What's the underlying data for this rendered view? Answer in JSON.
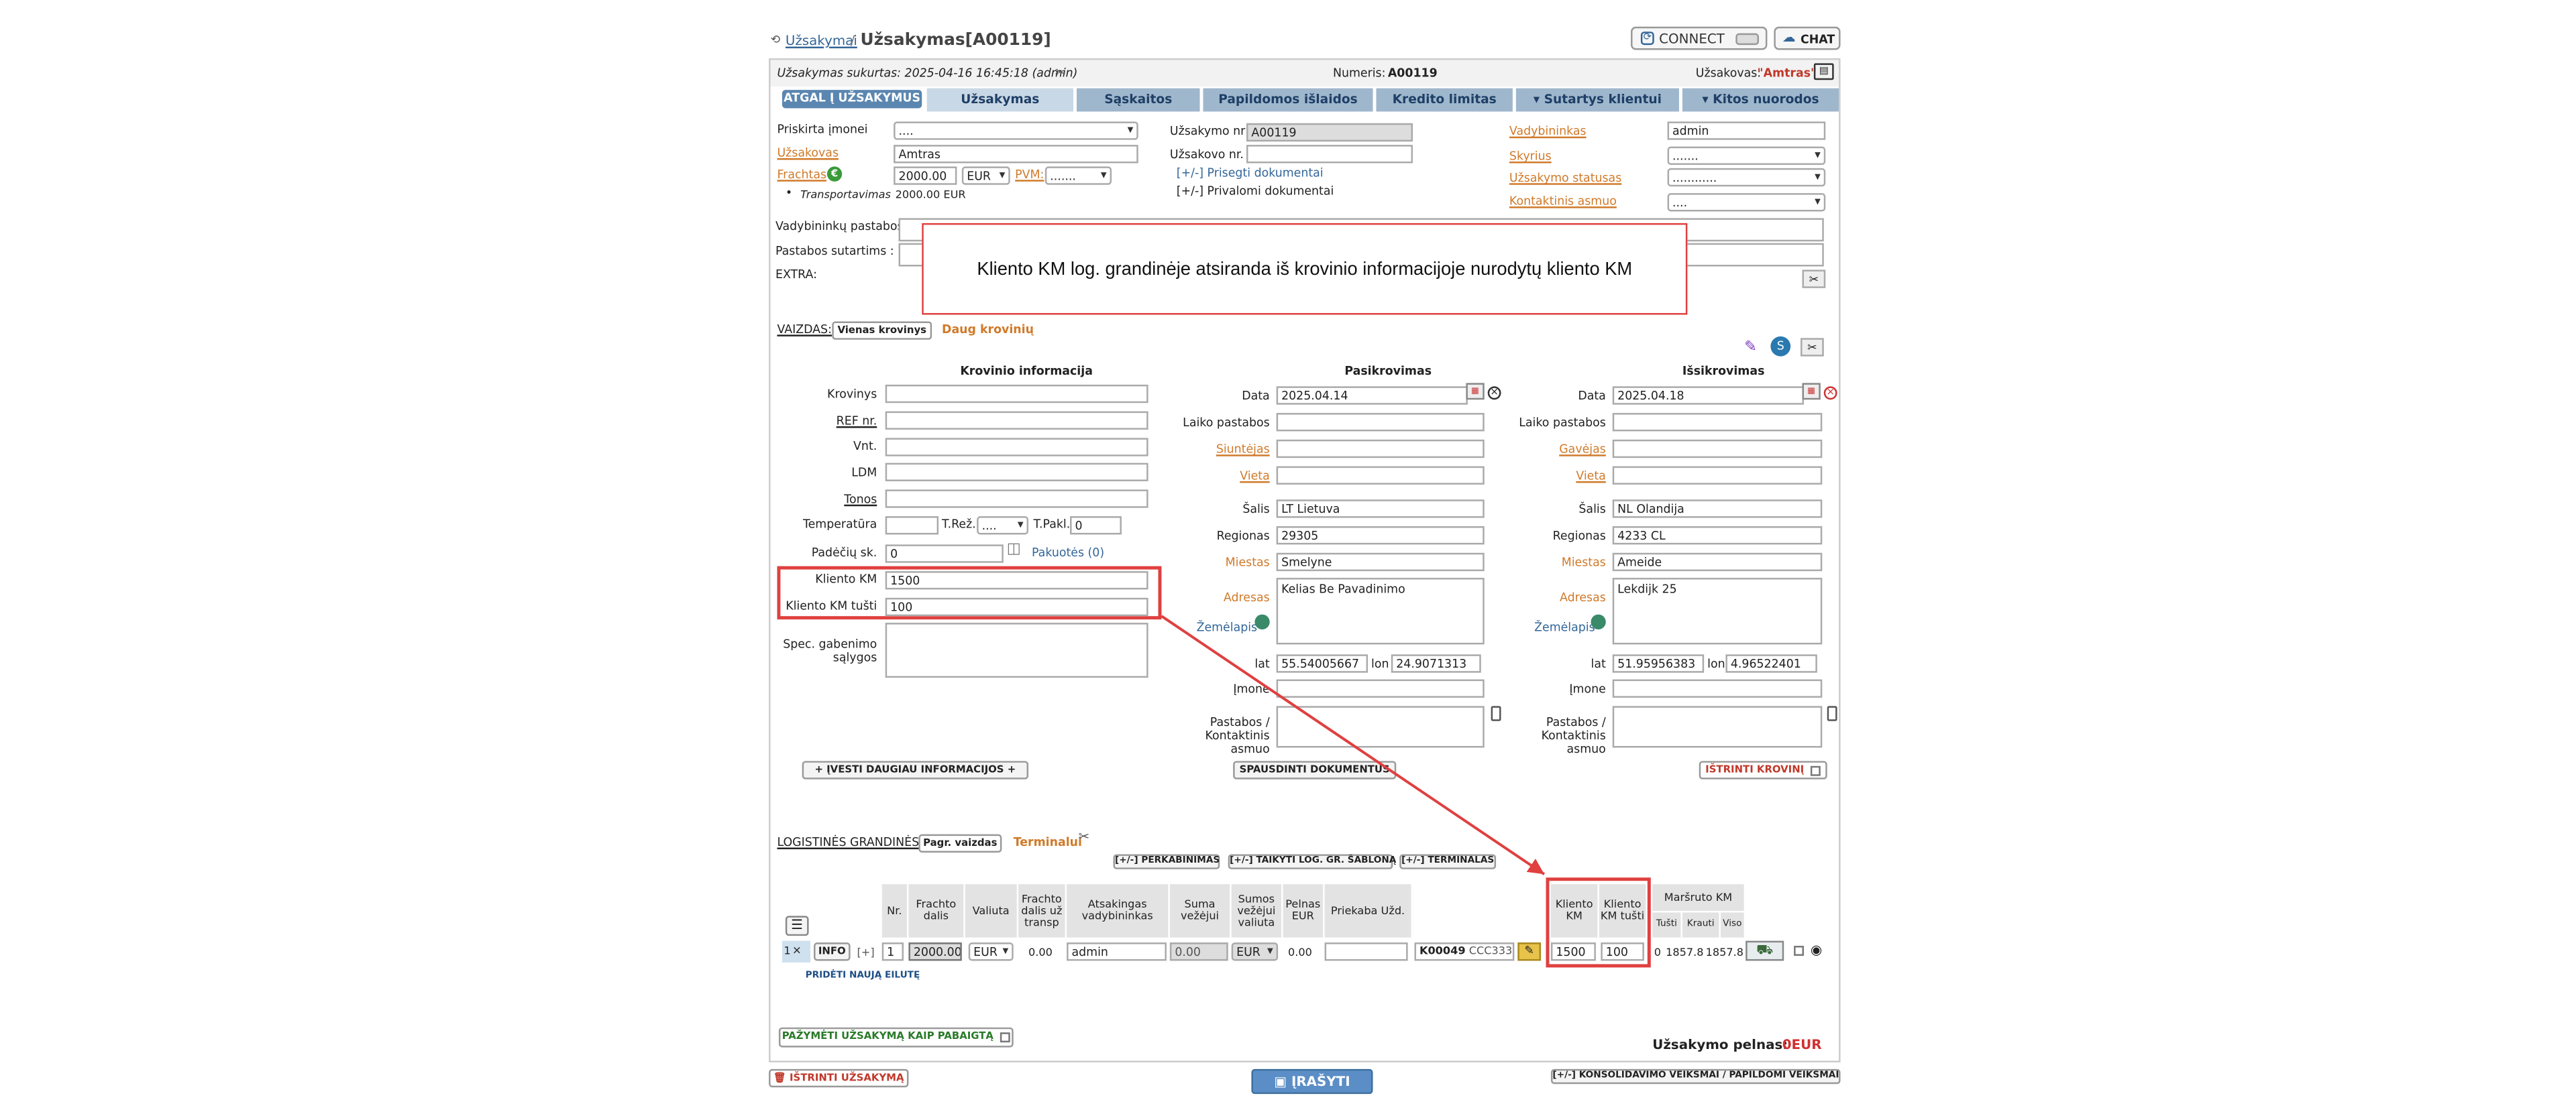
{
  "header": {
    "breadcrumb_link": "Užsakymai",
    "breadcrumb_sep": "/",
    "title": "Užsakymas[A00119]",
    "connect_label": "CONNECT",
    "chat_label": "CHAT"
  },
  "info": {
    "created": "Užsakymas sukurtas: 2025-04-16 16:45:18 (admin)",
    "number_label": "Numeris:",
    "number": "A00119",
    "customer_label": "Užsakovas:",
    "customer": "\"Amtras\""
  },
  "tabs": {
    "back": "ATGAL Į UŽSAKYMUS",
    "order": "Užsakymas",
    "invoices": "Sąskaitos",
    "extra_costs": "Papildomos išlaidos",
    "credit": "Kredito limitas",
    "contract": "Sutartys klientui",
    "other": "Kitos nuorodos"
  },
  "form": {
    "assigned_company_label": "Priskirta įmonei",
    "assigned_company": "....",
    "customer_label": "Užsakovas",
    "customer": "Amtras",
    "freight_label": "Frachtas",
    "freight_badge": "€",
    "freight_value": "2000.00",
    "freight_currency": "EUR",
    "vat_label": "PVM:",
    "vat_value": ".......",
    "transport_label": "Transportavimas",
    "transport_value": "2000.00 EUR",
    "order_nr_label": "Užsakymo nr",
    "order_nr": "A00119",
    "customer_nr_label": "Užsakovo nr. :",
    "customer_nr": "",
    "attach_docs": "[+/-] Prisegti dokumentai",
    "private_docs": "[+/-] Privalomi dokumentai",
    "manager_label": "Vadybininkas",
    "manager": "admin",
    "department_label": "Skyrius",
    "department": ".......",
    "status_label": "Užsakymo statusas",
    "status": "............",
    "contact_label": "Kontaktinis asmuo",
    "contact": "....",
    "manager_notes_label": "Vadybininkų pastabos :",
    "contract_notes_label": "Pastabos sutartims :",
    "extra_label": "EXTRA:"
  },
  "callout": "Kliento KM log. grandinėje atsiranda iš krovinio informacijoje nurodytų kliento KM",
  "view": {
    "label": "VAIZDAS:",
    "single": "Vienas krovinys",
    "many": "Daug krovinių"
  },
  "cargo": {
    "title": "Krovinio informacija",
    "cargo_label": "Krovinys",
    "ref_label": "REF nr.",
    "units_label": "Vnt.",
    "ldm_label": "LDM",
    "tons_label": "Tonos",
    "temp_label": "Temperatūra",
    "treg_label": "T.Rež.",
    "treg_value": "....",
    "tpakl_label": "T.Pakl.",
    "tpakl_value": "0",
    "pallets_label": "Padėčių sk.",
    "pallets_value": "0",
    "packages_link": "Pakuotės (0)",
    "client_km_label": "Kliento KM",
    "client_km": "1500",
    "client_km_empty_label": "Kliento KM tušti",
    "client_km_empty": "100",
    "spec_label": "Spec. gabenimo sąlygos"
  },
  "loading": {
    "title": "Pasikrovimas",
    "date_label": "Data",
    "date": "2025.04.14",
    "time_notes_label": "Laiko pastabos",
    "sender_label": "Siuntėjas",
    "place_label": "Vieta",
    "country_label": "Šalis",
    "country": "LT Lietuva",
    "region_label": "Regionas",
    "region": "29305",
    "city_label": "Miestas",
    "city": "Smelyne",
    "address_label": "Adresas",
    "address": "Kelias Be Pavadinimo",
    "map_label": "Žemėlapis",
    "lat_label": "lat",
    "lat": "55.54005667",
    "lon_label": "lon",
    "lon": "24.9071313",
    "company_label": "Įmone",
    "notes_label": "Pastabos / Kontaktinis asmuo"
  },
  "unloading": {
    "title": "Išsikrovimas",
    "date_label": "Data",
    "date": "2025.04.18",
    "time_notes_label": "Laiko pastabos",
    "receiver_label": "Gavėjas",
    "place_label": "Vieta",
    "country_label": "Šalis",
    "country": "NL Olandija",
    "region_label": "Regionas",
    "region": "4233 CL",
    "city_label": "Miestas",
    "city": "Ameide",
    "address_label": "Adresas",
    "address": "Lekdijk 25",
    "map_label": "Žemėlapis",
    "lat_label": "lat",
    "lat": "51.95956383",
    "lon_label": "lon",
    "lon": "4.96522401",
    "company_label": "Įmone",
    "notes_label": "Pastabos / Kontaktinis asmuo"
  },
  "actions": {
    "more_info": "+ ĮVESTI DAUGIAU INFORMACIJOS +",
    "print_docs": "SPAUSDINTI DOKUMENTUS",
    "delete_cargo": "IŠTRINTI KROVINĮ"
  },
  "chain": {
    "label": "LOGISTINĖS GRANDINĖS:",
    "basic_view": "Pagr. vaizdas",
    "terminals": "Terminalui",
    "reload": "[+/-] PERKABINIMAS",
    "apply_template": "[+/-] TAIKYTI LOG. GR. ŠABLONĄ",
    "terminal": "[+/-] TERMINALAS",
    "headers": [
      "Nr.",
      "Frachto dalis",
      "Valiuta",
      "Frachto dalis už transp",
      "Atsakingas vadybininkas",
      "Suma vežėjui",
      "Sumos vežėjui valiuta",
      "Pelnas EUR",
      "Priekaba Užd.",
      "Kliento KM",
      "Kliento KM tušti",
      "Maršruto KM",
      "Tušti",
      "Krauti",
      "Viso"
    ],
    "row": {
      "idx": "1",
      "info": "INFO",
      "plus": "[+]",
      "nr": "1",
      "freight": "2000.00",
      "currency": "EUR",
      "freight_transp": "0.00",
      "manager": "admin",
      "carrier_sum": "0.00",
      "carrier_currency": "EUR",
      "profit": "0.00",
      "trailer": "",
      "truck": "K00049",
      "truck2": "CCC333",
      "client_km": "1500",
      "client_km_empty": "100",
      "km_empty": "0",
      "km_loaded": "1857.8",
      "km_total": "1857.8"
    },
    "add_row": "PRIDĖTI NAUJĄ EILUTĘ"
  },
  "footer": {
    "mark_done": "PAŽYMĖTI UŽSAKYMĄ KAIP PABAIGTĄ",
    "profit_label": "Užsakymo pelnas:",
    "profit": "0EUR",
    "delete_order": "IŠTRINTI UŽSAKYMĄ",
    "save": "ĮRAŠYTI",
    "consolidation": "[+/-] KONSOLIDAVIMO VEIKSMAI / PAPILDOMI VEIKSMAI"
  },
  "colors": {
    "tab_bg": "#9fb7cd",
    "active_tab": "#c9d8e6",
    "back_tab": "#5a86b0",
    "orange": "#d07a2a",
    "red": "#e04040",
    "save": "#5b8ec6"
  }
}
